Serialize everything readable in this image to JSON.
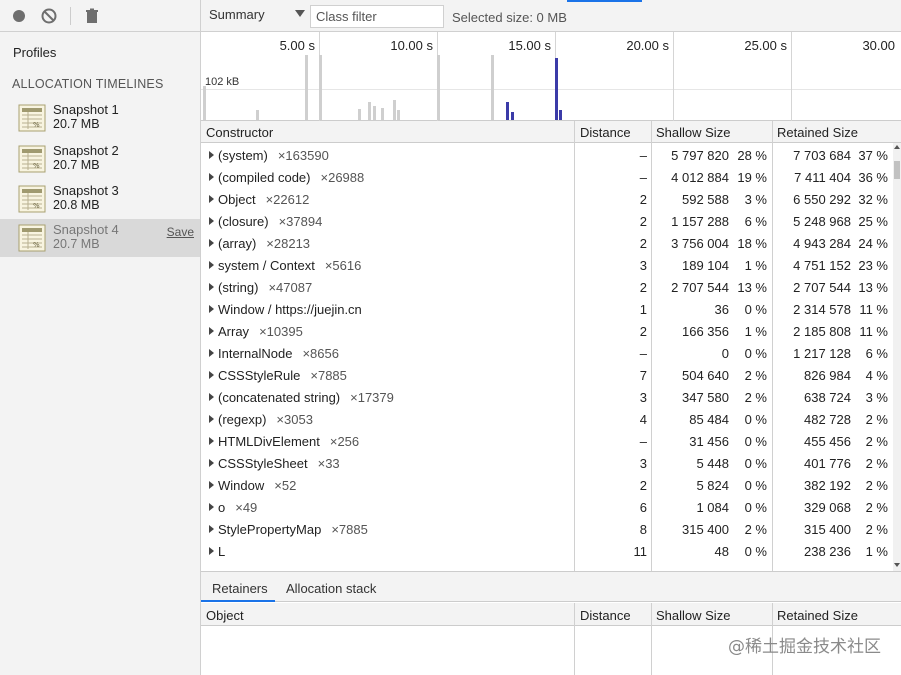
{
  "sidebar": {
    "toolbar": {
      "record_icon": "record-icon",
      "clear_icon": "clear-icon",
      "delete_icon": "trash-icon"
    },
    "profiles_title": "Profiles",
    "section_title": "ALLOCATION TIMELINES",
    "snapshots": [
      {
        "name": "Snapshot 1",
        "size": "20.7 MB"
      },
      {
        "name": "Snapshot 2",
        "size": "20.7 MB"
      },
      {
        "name": "Snapshot 3",
        "size": "20.8 MB"
      },
      {
        "name": "Snapshot 4",
        "size": "20.7 MB",
        "selected": true,
        "save_label": "Save"
      }
    ]
  },
  "toolbar": {
    "view_select": "Summary",
    "class_filter_placeholder": "Class filter",
    "selected_size": "Selected size: 0 MB"
  },
  "timeline": {
    "ticks": [
      "5.00 s",
      "10.00 s",
      "15.00 s",
      "20.00 s",
      "25.00 s",
      "30.00"
    ],
    "memory_label": "102 kB"
  },
  "grid": {
    "columns": [
      "Constructor",
      "Distance",
      "Shallow Size",
      "Retained Size"
    ],
    "rows": [
      {
        "name": "(system)",
        "count": "×163590",
        "distance": "–",
        "shallow": "5 797 820",
        "shallow_pct": "28 %",
        "retained": "7 703 684",
        "retained_pct": "37 %"
      },
      {
        "name": "(compiled code)",
        "count": "×26988",
        "distance": "–",
        "shallow": "4 012 884",
        "shallow_pct": "19 %",
        "retained": "7 411 404",
        "retained_pct": "36 %"
      },
      {
        "name": "Object",
        "count": "×22612",
        "distance": "2",
        "shallow": "592 588",
        "shallow_pct": "3 %",
        "retained": "6 550 292",
        "retained_pct": "32 %"
      },
      {
        "name": "(closure)",
        "count": "×37894",
        "distance": "2",
        "shallow": "1 157 288",
        "shallow_pct": "6 %",
        "retained": "5 248 968",
        "retained_pct": "25 %"
      },
      {
        "name": "(array)",
        "count": "×28213",
        "distance": "2",
        "shallow": "3 756 004",
        "shallow_pct": "18 %",
        "retained": "4 943 284",
        "retained_pct": "24 %"
      },
      {
        "name": "system / Context",
        "count": "×5616",
        "distance": "3",
        "shallow": "189 104",
        "shallow_pct": "1 %",
        "retained": "4 751 152",
        "retained_pct": "23 %"
      },
      {
        "name": "(string)",
        "count": "×47087",
        "distance": "2",
        "shallow": "2 707 544",
        "shallow_pct": "13 %",
        "retained": "2 707 544",
        "retained_pct": "13 %"
      },
      {
        "name": "Window / https://juejin.cn",
        "count": "",
        "distance": "1",
        "shallow": "36",
        "shallow_pct": "0 %",
        "retained": "2 314 578",
        "retained_pct": "11 %"
      },
      {
        "name": "Array",
        "count": "×10395",
        "distance": "2",
        "shallow": "166 356",
        "shallow_pct": "1 %",
        "retained": "2 185 808",
        "retained_pct": "11 %"
      },
      {
        "name": "InternalNode",
        "count": "×8656",
        "distance": "–",
        "shallow": "0",
        "shallow_pct": "0 %",
        "retained": "1 217 128",
        "retained_pct": "6 %"
      },
      {
        "name": "CSSStyleRule",
        "count": "×7885",
        "distance": "7",
        "shallow": "504 640",
        "shallow_pct": "2 %",
        "retained": "826 984",
        "retained_pct": "4 %"
      },
      {
        "name": "(concatenated string)",
        "count": "×17379",
        "distance": "3",
        "shallow": "347 580",
        "shallow_pct": "2 %",
        "retained": "638 724",
        "retained_pct": "3 %"
      },
      {
        "name": "(regexp)",
        "count": "×3053",
        "distance": "4",
        "shallow": "85 484",
        "shallow_pct": "0 %",
        "retained": "482 728",
        "retained_pct": "2 %"
      },
      {
        "name": "HTMLDivElement",
        "count": "×256",
        "distance": "–",
        "shallow": "31 456",
        "shallow_pct": "0 %",
        "retained": "455 456",
        "retained_pct": "2 %"
      },
      {
        "name": "CSSStyleSheet",
        "count": "×33",
        "distance": "3",
        "shallow": "5 448",
        "shallow_pct": "0 %",
        "retained": "401 776",
        "retained_pct": "2 %"
      },
      {
        "name": "Window",
        "count": "×52",
        "distance": "2",
        "shallow": "5 824",
        "shallow_pct": "0 %",
        "retained": "382 192",
        "retained_pct": "2 %"
      },
      {
        "name": "o",
        "count": "×49",
        "distance": "6",
        "shallow": "1 084",
        "shallow_pct": "0 %",
        "retained": "329 068",
        "retained_pct": "2 %"
      },
      {
        "name": "StylePropertyMap",
        "count": "×7885",
        "distance": "8",
        "shallow": "315 400",
        "shallow_pct": "2 %",
        "retained": "315 400",
        "retained_pct": "2 %"
      },
      {
        "name": "L",
        "count": "",
        "distance": "11",
        "shallow": "48",
        "shallow_pct": "0 %",
        "retained": "238 236",
        "retained_pct": "1 %"
      }
    ]
  },
  "bottom": {
    "tabs": [
      "Retainers",
      "Allocation stack"
    ],
    "columns": [
      "Object",
      "Distance",
      "Shallow Size",
      "Retained Size"
    ]
  },
  "watermark": "@稀土掘金技术社区"
}
